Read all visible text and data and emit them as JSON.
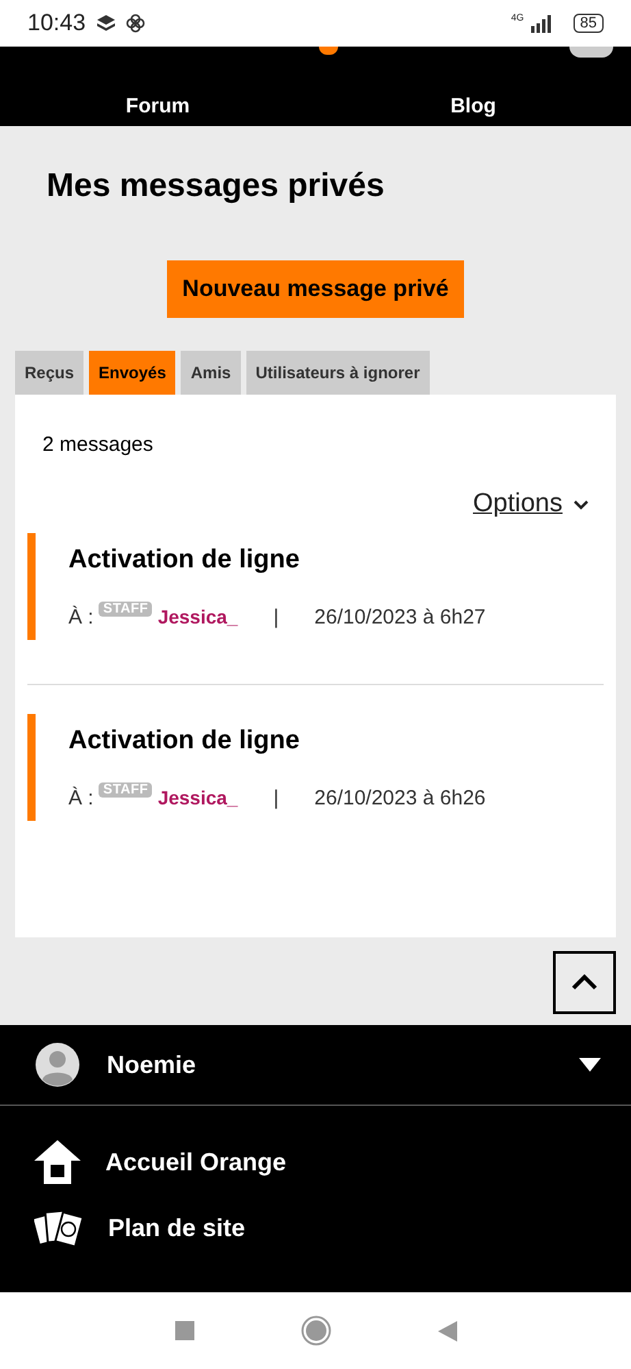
{
  "status_bar": {
    "time": "10:43",
    "network": "4G",
    "battery": "85"
  },
  "header": {
    "nav": [
      {
        "label": "Forum"
      },
      {
        "label": "Blog"
      }
    ]
  },
  "page": {
    "title": "Mes messages privés",
    "new_button": "Nouveau message privé"
  },
  "tabs": [
    {
      "label": "Reçus",
      "selected": false
    },
    {
      "label": "Envoyés",
      "selected": true
    },
    {
      "label": "Amis",
      "selected": false
    },
    {
      "label": "Utilisateurs à ignorer",
      "selected": false
    }
  ],
  "count": "2 messages",
  "options": "Options",
  "messages": [
    {
      "subject": "Activation de ligne",
      "to_label": "À :",
      "badge": "STAFF",
      "recipient": "Jessica_",
      "separator": "|",
      "date": "26/10/2023 à 6h27"
    },
    {
      "subject": "Activation de ligne",
      "to_label": "À :",
      "badge": "STAFF",
      "recipient": "Jessica_",
      "separator": "|",
      "date": "26/10/2023 à 6h26"
    }
  ],
  "footer": {
    "user": "Noemie",
    "expanded": false,
    "links": [
      {
        "kind": "home",
        "label": "Accueil Orange"
      },
      {
        "kind": "sitemap",
        "label": "Plan de site"
      }
    ]
  }
}
